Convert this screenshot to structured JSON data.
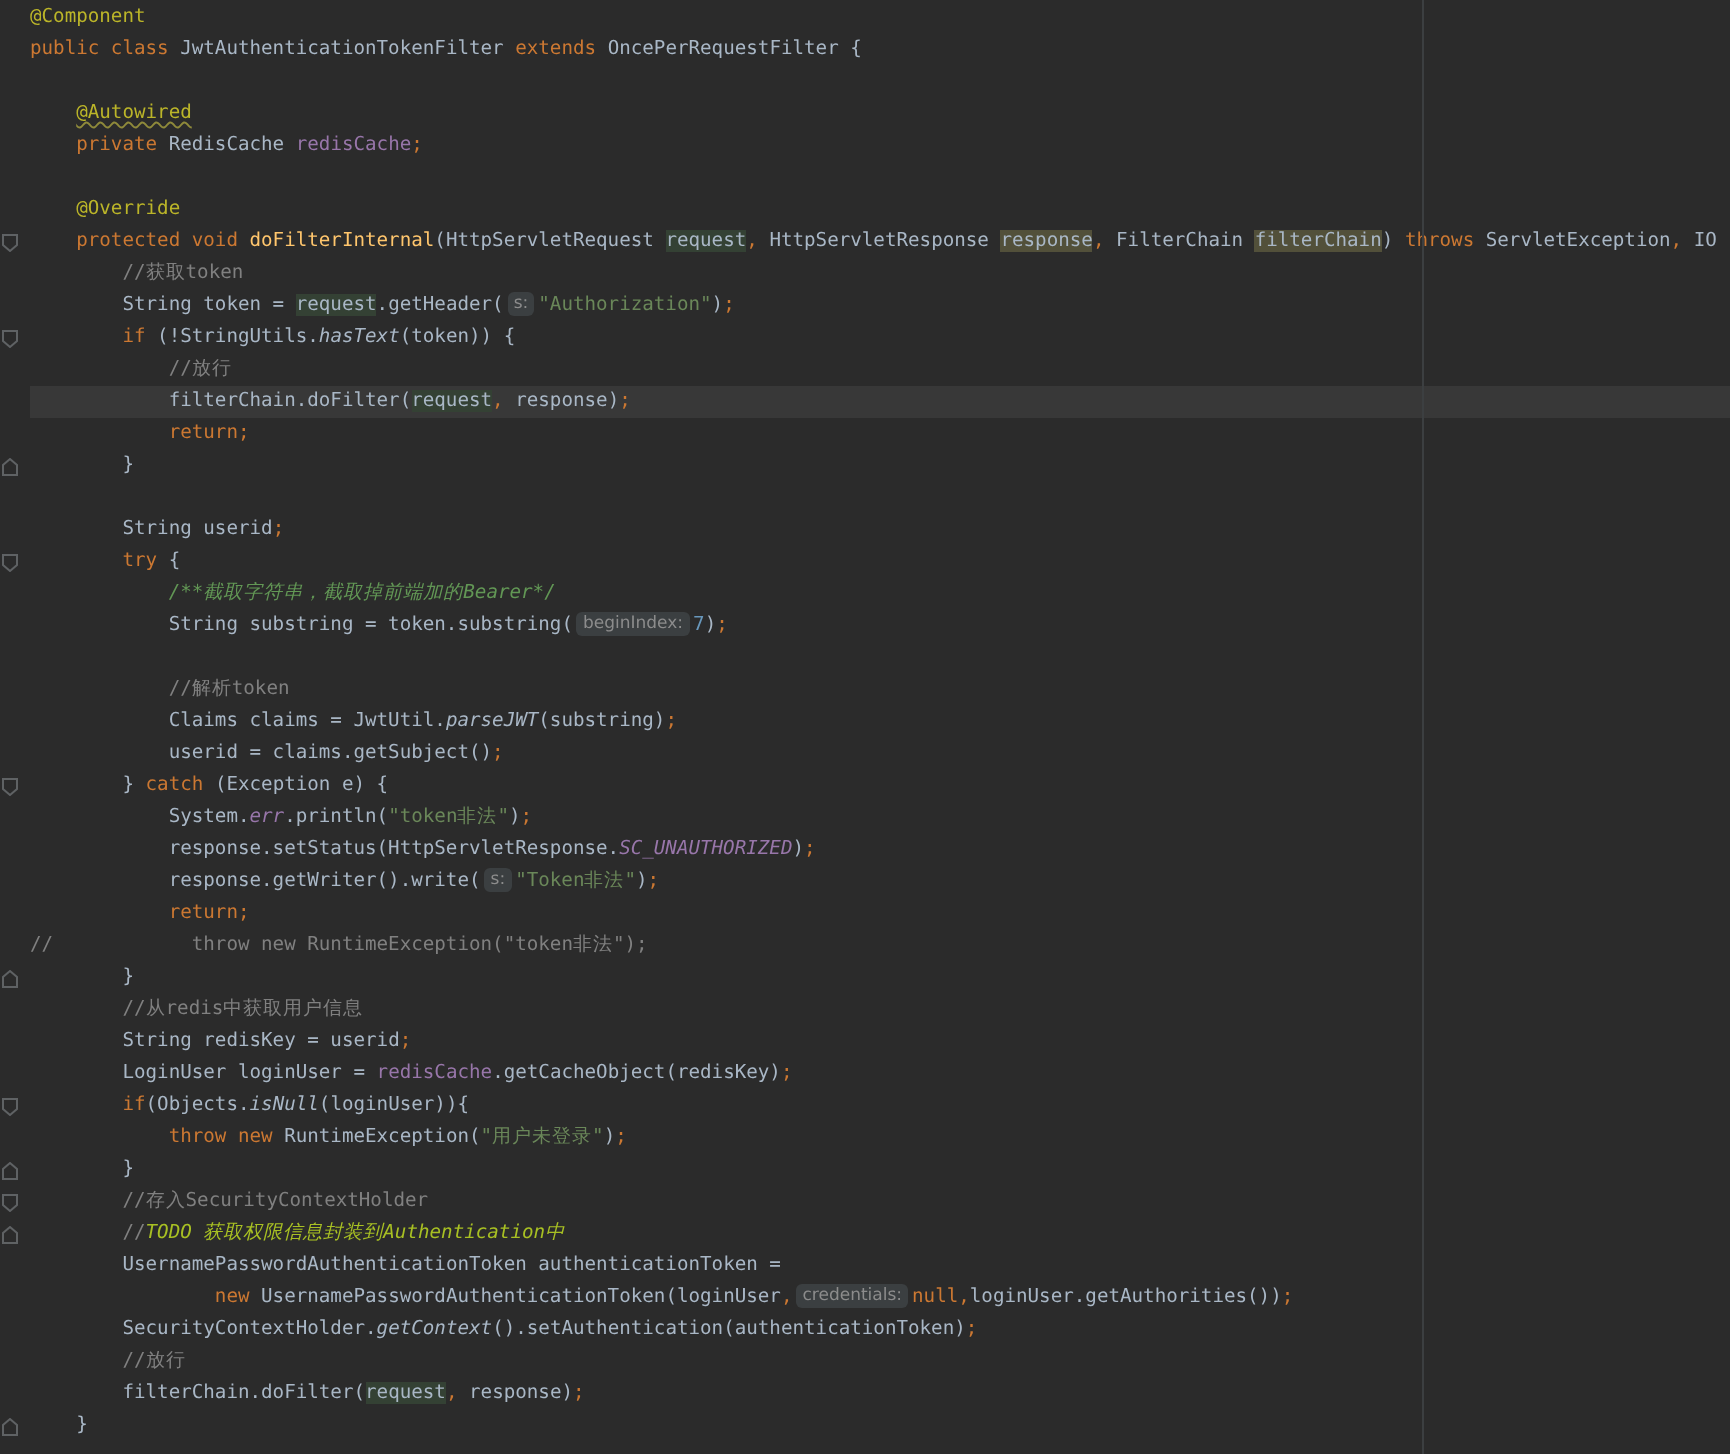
{
  "editor": {
    "lines": [
      {
        "kind": "code",
        "current": false,
        "tokens": [
          {
            "kind": "ann",
            "text": "@Component"
          }
        ]
      },
      {
        "kind": "code",
        "current": false,
        "tokens": [
          {
            "kind": "kw",
            "text": "public class "
          },
          {
            "kind": "plain",
            "text": "JwtAuthenticationTokenFilter "
          },
          {
            "kind": "kw",
            "text": "extends "
          },
          {
            "kind": "plain",
            "text": "OncePerRequestFilter {"
          }
        ]
      },
      {
        "kind": "code",
        "current": false
      },
      {
        "kind": "code",
        "current": false,
        "tokens": [
          {
            "kind": "annw",
            "text": "    @Autowired"
          }
        ]
      },
      {
        "kind": "code",
        "current": false,
        "tokens": [
          {
            "kind": "kw",
            "text": "    private "
          },
          {
            "kind": "plain",
            "text": "RedisCache "
          },
          {
            "kind": "fld",
            "text": "redisCache"
          },
          {
            "kind": "punct",
            "text": ";"
          }
        ]
      },
      {
        "kind": "code",
        "current": false
      },
      {
        "kind": "code",
        "current": false,
        "tokens": [
          {
            "kind": "ann",
            "text": "    @Override"
          }
        ]
      },
      {
        "kind": "opener",
        "current": false,
        "tokens": [
          {
            "kind": "kw",
            "text": "    protected void "
          },
          {
            "kind": "decl",
            "text": "doFilterInternal"
          },
          {
            "kind": "plain",
            "text": "(HttpServletRequest "
          },
          {
            "kind": "pread",
            "text": "request"
          },
          {
            "kind": "punct",
            "text": ", "
          },
          {
            "kind": "plain",
            "text": "HttpServletResponse "
          },
          {
            "kind": "pdecl",
            "text": "response"
          },
          {
            "kind": "punct",
            "text": ", "
          },
          {
            "kind": "plain",
            "text": "FilterChain "
          },
          {
            "kind": "pdecl",
            "text": "filterChain"
          },
          {
            "kind": "plain",
            "text": ") "
          },
          {
            "kind": "kw",
            "text": "throws "
          },
          {
            "kind": "plain",
            "text": "ServletException"
          },
          {
            "kind": "punct",
            "text": ", "
          },
          {
            "kind": "plain",
            "text": "IO"
          }
        ]
      },
      {
        "kind": "code",
        "current": false,
        "tokens": [
          {
            "kind": "cmt",
            "text": "        //获取token"
          }
        ]
      },
      {
        "kind": "code",
        "current": false,
        "tokens": [
          {
            "kind": "plain",
            "text": "        String token = "
          },
          {
            "kind": "pread",
            "text": "request"
          },
          {
            "kind": "plain",
            "text": ".getHeader("
          },
          {
            "kind": "hint",
            "text": "s:"
          },
          {
            "kind": "str",
            "text": "\"Authorization\""
          },
          {
            "kind": "plain",
            "text": ")"
          },
          {
            "kind": "punct",
            "text": ";"
          }
        ]
      },
      {
        "kind": "opener",
        "current": false,
        "tokens": [
          {
            "kind": "kw",
            "text": "        if "
          },
          {
            "kind": "plain",
            "text": "(!StringUtils."
          },
          {
            "kind": "stat",
            "text": "hasText"
          },
          {
            "kind": "plain",
            "text": "(token)) {"
          }
        ]
      },
      {
        "kind": "code",
        "current": false,
        "tokens": [
          {
            "kind": "cmt",
            "text": "            //放行"
          }
        ]
      },
      {
        "kind": "code",
        "current": true,
        "tokens": [
          {
            "kind": "plain",
            "text": "            filterChain.doFilter("
          },
          {
            "kind": "pread",
            "text": "request"
          },
          {
            "kind": "punct",
            "text": ", "
          },
          {
            "kind": "plain",
            "text": "response)"
          },
          {
            "kind": "punct",
            "text": ";"
          }
        ]
      },
      {
        "kind": "code",
        "current": false,
        "tokens": [
          {
            "kind": "kw",
            "text": "            return"
          },
          {
            "kind": "punct",
            "text": ";"
          }
        ]
      },
      {
        "kind": "closer",
        "current": false,
        "tokens": [
          {
            "kind": "plain",
            "text": "        }"
          }
        ]
      },
      {
        "kind": "code",
        "current": false
      },
      {
        "kind": "code",
        "current": false,
        "tokens": [
          {
            "kind": "plain",
            "text": "        String userid"
          },
          {
            "kind": "punct",
            "text": ";"
          }
        ]
      },
      {
        "kind": "opener",
        "current": false,
        "tokens": [
          {
            "kind": "kw",
            "text": "        try "
          },
          {
            "kind": "plain",
            "text": "{"
          }
        ]
      },
      {
        "kind": "code",
        "current": false,
        "tokens": [
          {
            "kind": "doc",
            "text": "            /**截取字符串，截取掉前端加的Bearer*/"
          }
        ]
      },
      {
        "kind": "code",
        "current": false,
        "tokens": [
          {
            "kind": "plain",
            "text": "            String substring = token.substring("
          },
          {
            "kind": "hint",
            "text": "beginIndex:"
          },
          {
            "kind": "num",
            "text": "7"
          },
          {
            "kind": "plain",
            "text": ")"
          },
          {
            "kind": "punct",
            "text": ";"
          }
        ]
      },
      {
        "kind": "code",
        "current": false
      },
      {
        "kind": "code",
        "current": false,
        "tokens": [
          {
            "kind": "cmt",
            "text": "            //解析token"
          }
        ]
      },
      {
        "kind": "code",
        "current": false,
        "tokens": [
          {
            "kind": "plain",
            "text": "            Claims claims = JwtUtil."
          },
          {
            "kind": "stat",
            "text": "parseJWT"
          },
          {
            "kind": "plain",
            "text": "(substring)"
          },
          {
            "kind": "punct",
            "text": ";"
          }
        ]
      },
      {
        "kind": "code",
        "current": false,
        "tokens": [
          {
            "kind": "plain",
            "text": "            userid = claims.getSubject()"
          },
          {
            "kind": "punct",
            "text": ";"
          }
        ]
      },
      {
        "kind": "opener",
        "current": false,
        "tokens": [
          {
            "kind": "plain",
            "text": "        } "
          },
          {
            "kind": "kw",
            "text": "catch "
          },
          {
            "kind": "plain",
            "text": "(Exception e) {"
          }
        ]
      },
      {
        "kind": "code",
        "current": false,
        "tokens": [
          {
            "kind": "plain",
            "text": "            System."
          },
          {
            "kind": "fldi",
            "text": "err"
          },
          {
            "kind": "plain",
            "text": ".println("
          },
          {
            "kind": "str",
            "text": "\"token非法\""
          },
          {
            "kind": "plain",
            "text": ")"
          },
          {
            "kind": "punct",
            "text": ";"
          }
        ]
      },
      {
        "kind": "code",
        "current": false,
        "tokens": [
          {
            "kind": "plain",
            "text": "            response.setStatus(HttpServletResponse."
          },
          {
            "kind": "fldi",
            "text": "SC_UNAUTHORIZED"
          },
          {
            "kind": "plain",
            "text": ")"
          },
          {
            "kind": "punct",
            "text": ";"
          }
        ]
      },
      {
        "kind": "code",
        "current": false,
        "tokens": [
          {
            "kind": "plain",
            "text": "            response.getWriter().write("
          },
          {
            "kind": "hint",
            "text": "s:"
          },
          {
            "kind": "str",
            "text": "\"Token非法\""
          },
          {
            "kind": "plain",
            "text": ")"
          },
          {
            "kind": "punct",
            "text": ";"
          }
        ]
      },
      {
        "kind": "code",
        "current": false,
        "tokens": [
          {
            "kind": "kw",
            "text": "            return"
          },
          {
            "kind": "punct",
            "text": ";"
          }
        ]
      },
      {
        "kind": "code",
        "current": false,
        "tokens": [
          {
            "kind": "cmt",
            "text": "//            throw new RuntimeException(\"token非法\");"
          }
        ]
      },
      {
        "kind": "closer",
        "current": false,
        "tokens": [
          {
            "kind": "plain",
            "text": "        }"
          }
        ]
      },
      {
        "kind": "code",
        "current": false,
        "tokens": [
          {
            "kind": "cmt",
            "text": "        //从redis中获取用户信息"
          }
        ]
      },
      {
        "kind": "code",
        "current": false,
        "tokens": [
          {
            "kind": "plain",
            "text": "        String redisKey = userid"
          },
          {
            "kind": "punct",
            "text": ";"
          }
        ]
      },
      {
        "kind": "code",
        "current": false,
        "tokens": [
          {
            "kind": "plain",
            "text": "        LoginUser loginUser = "
          },
          {
            "kind": "fld",
            "text": "redisCache"
          },
          {
            "kind": "plain",
            "text": ".getCacheObject(redisKey)"
          },
          {
            "kind": "punct",
            "text": ";"
          }
        ]
      },
      {
        "kind": "opener",
        "current": false,
        "tokens": [
          {
            "kind": "kw",
            "text": "        if"
          },
          {
            "kind": "plain",
            "text": "(Objects."
          },
          {
            "kind": "stat",
            "text": "isNull"
          },
          {
            "kind": "plain",
            "text": "(loginUser)){"
          }
        ]
      },
      {
        "kind": "code",
        "current": false,
        "tokens": [
          {
            "kind": "kw",
            "text": "            throw new "
          },
          {
            "kind": "plain",
            "text": "RuntimeException("
          },
          {
            "kind": "str",
            "text": "\"用户未登录\""
          },
          {
            "kind": "plain",
            "text": ")"
          },
          {
            "kind": "punct",
            "text": ";"
          }
        ]
      },
      {
        "kind": "closer",
        "current": false,
        "tokens": [
          {
            "kind": "plain",
            "text": "        }"
          }
        ]
      },
      {
        "kind": "opener",
        "current": false,
        "tokens": [
          {
            "kind": "cmt",
            "text": "        //存入SecurityContextHolder"
          }
        ]
      },
      {
        "kind": "closer",
        "current": false,
        "tokens": [
          {
            "kind": "cmt",
            "text": "        //"
          },
          {
            "kind": "todo",
            "text": "TODO 获取权限信息封装到Authentication中"
          }
        ]
      },
      {
        "kind": "code",
        "current": false,
        "tokens": [
          {
            "kind": "plain",
            "text": "        UsernamePasswordAuthenticationToken authenticationToken ="
          }
        ]
      },
      {
        "kind": "code",
        "current": false,
        "tokens": [
          {
            "kind": "kw",
            "text": "                new "
          },
          {
            "kind": "plain",
            "text": "UsernamePasswordAuthenticationToken(loginUser"
          },
          {
            "kind": "punct",
            "text": ","
          },
          {
            "kind": "hint",
            "text": "credentials:"
          },
          {
            "kind": "kw",
            "text": "null"
          },
          {
            "kind": "punct",
            "text": ","
          },
          {
            "kind": "plain",
            "text": "loginUser.getAuthorities())"
          },
          {
            "kind": "punct",
            "text": ";"
          }
        ]
      },
      {
        "kind": "code",
        "current": false,
        "tokens": [
          {
            "kind": "plain",
            "text": "        SecurityContextHolder."
          },
          {
            "kind": "stat",
            "text": "getContext"
          },
          {
            "kind": "plain",
            "text": "().setAuthentication(authenticationToken)"
          },
          {
            "kind": "punct",
            "text": ";"
          }
        ]
      },
      {
        "kind": "code",
        "current": false,
        "tokens": [
          {
            "kind": "cmt",
            "text": "        //放行"
          }
        ]
      },
      {
        "kind": "code",
        "current": false,
        "tokens": [
          {
            "kind": "plain",
            "text": "        filterChain.doFilter("
          },
          {
            "kind": "pread",
            "text": "request"
          },
          {
            "kind": "punct",
            "text": ", "
          },
          {
            "kind": "plain",
            "text": "response)"
          },
          {
            "kind": "punct",
            "text": ";"
          }
        ]
      },
      {
        "kind": "closer",
        "current": false,
        "tokens": [
          {
            "kind": "plain",
            "text": "    }"
          }
        ]
      }
    ]
  }
}
